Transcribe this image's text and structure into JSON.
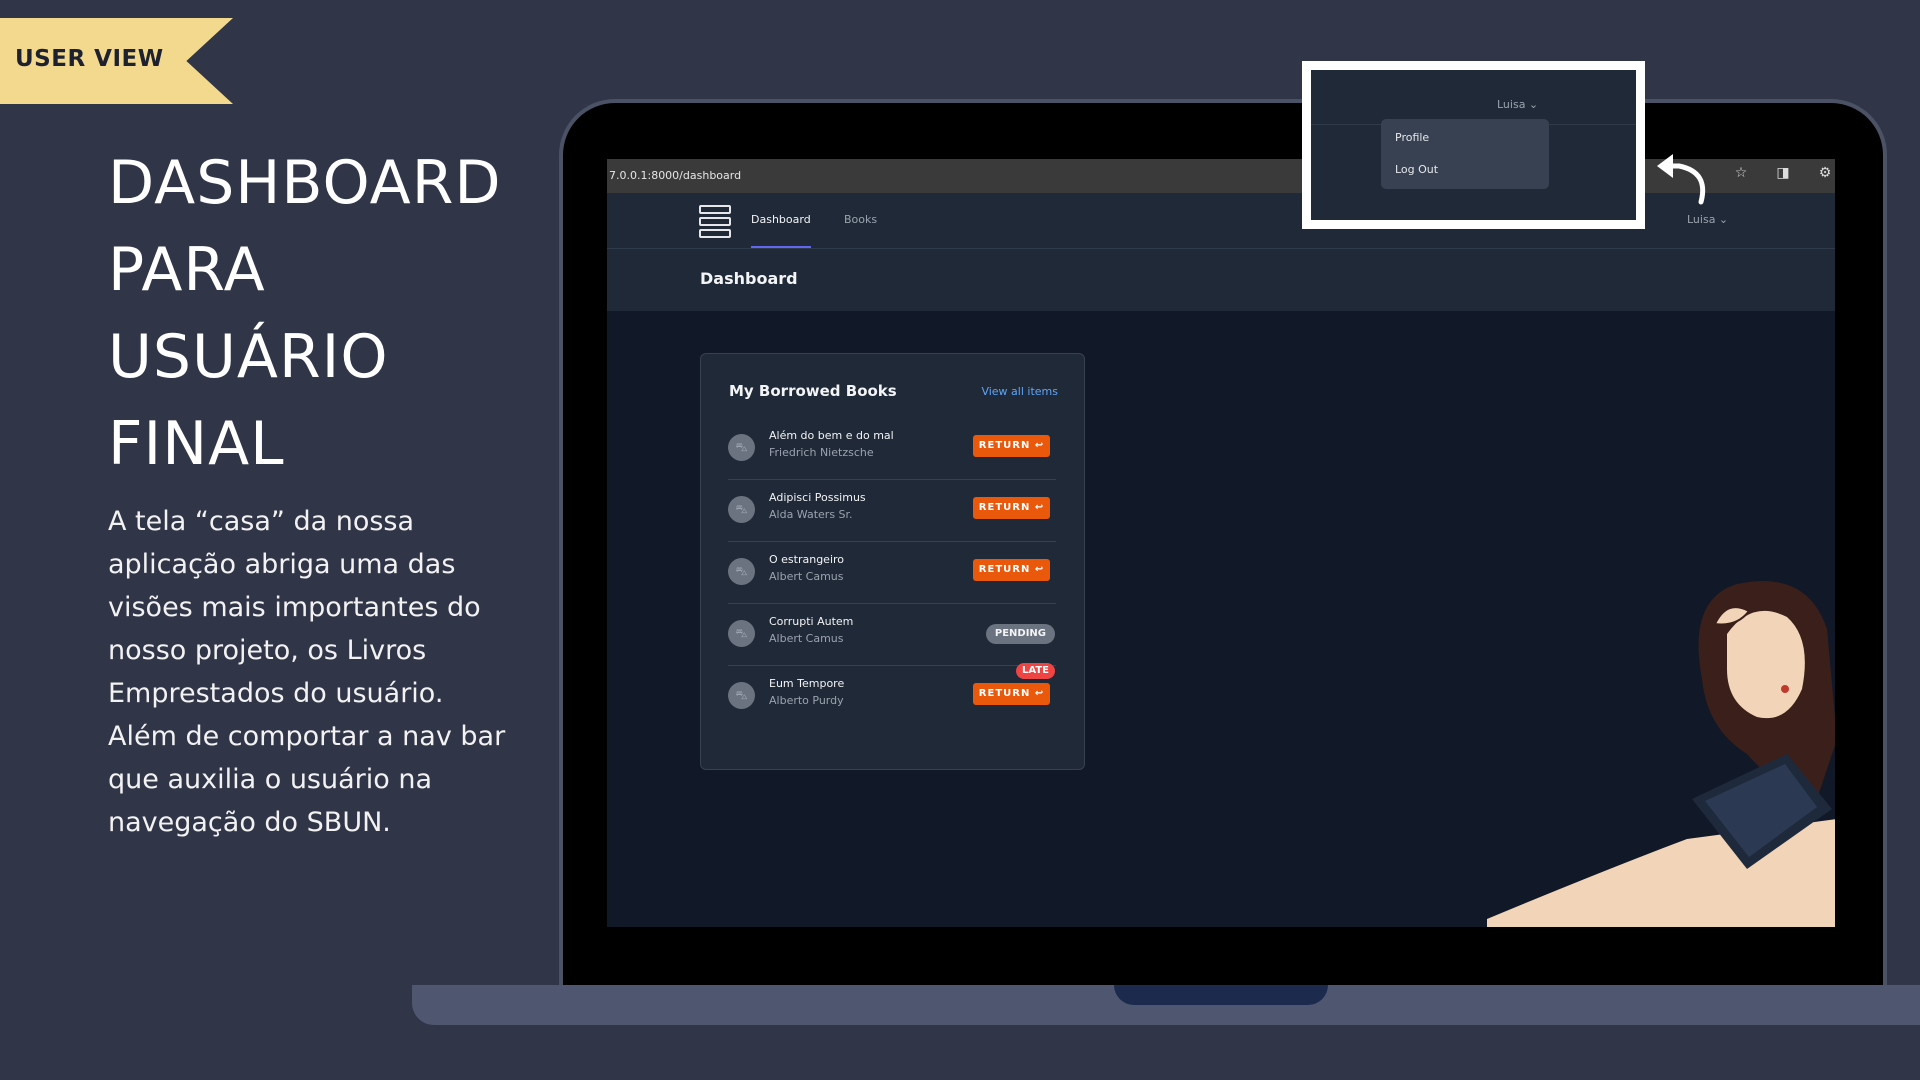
{
  "banner": {
    "label": "USER VIEW"
  },
  "slide": {
    "title_lines": [
      "DASHBOARD",
      "PARA",
      "USUÁRIO",
      "FINAL"
    ],
    "description": "A tela “casa” da nossa aplicação abriga uma das visões mais importantes do nosso projeto, os Livros Emprestados do usuário. Além de comportar a nav bar que auxilia o usuário na navegação do SBUN."
  },
  "browser": {
    "url": "7.0.0.1:8000/dashboard",
    "icons": [
      "star-icon",
      "sidebar-icon",
      "extension-icon"
    ]
  },
  "nav": {
    "links": [
      {
        "label": "Dashboard",
        "active": true
      },
      {
        "label": "Books",
        "active": false
      }
    ],
    "user": "Luisa ⌄"
  },
  "page": {
    "title": "Dashboard"
  },
  "borrowed_card": {
    "title": "My Borrowed Books",
    "view_all": "View all items",
    "books": [
      {
        "title": "Além do bem e do mal",
        "author": "Friedrich Nietzsche",
        "action": "RETURN ↩",
        "status": "return"
      },
      {
        "title": "Adipisci Possimus",
        "author": "Alda Waters Sr.",
        "action": "RETURN ↩",
        "status": "return"
      },
      {
        "title": "O estrangeiro",
        "author": "Albert Camus",
        "action": "RETURN ↩",
        "status": "return"
      },
      {
        "title": "Corrupti Autem",
        "author": "Albert Camus",
        "action": "PENDING",
        "status": "pending"
      },
      {
        "title": "Eum Tempore",
        "author": "Alberto Purdy",
        "action": "RETURN ↩",
        "status": "late",
        "late_label": "LATE"
      }
    ]
  },
  "callout": {
    "user": "Luisa ⌄",
    "menu": [
      "Profile",
      "Log Out"
    ]
  },
  "colors": {
    "background": "#303548",
    "banner": "#f3d98d",
    "return_button": "#ea580c",
    "late_badge": "#ef4444",
    "link": "#60a5fa",
    "active_tab": "#6366f1"
  }
}
